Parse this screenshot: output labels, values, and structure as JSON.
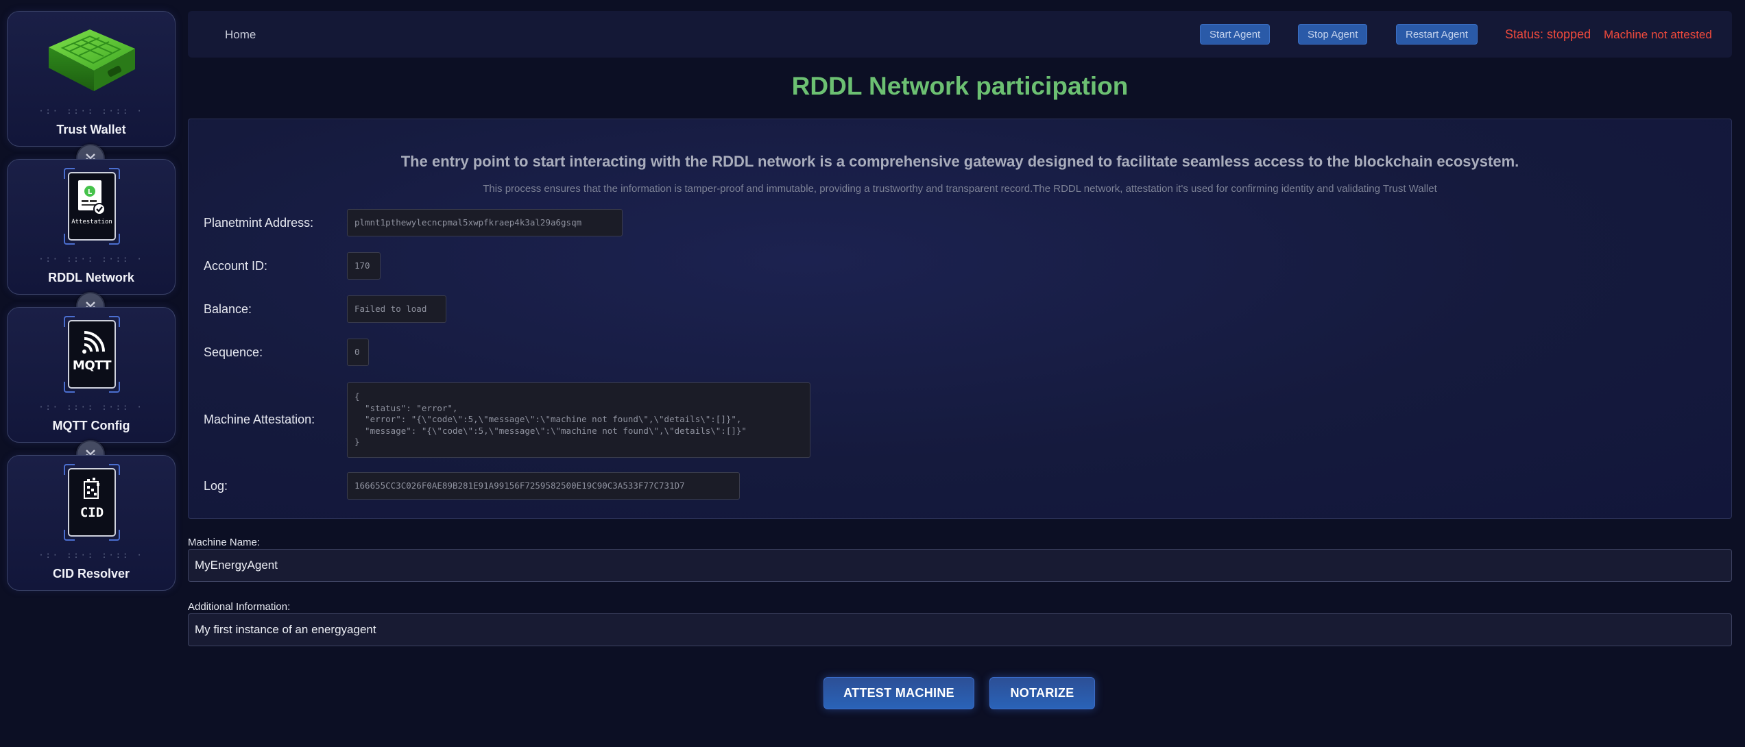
{
  "sidebar": {
    "items": [
      {
        "label": "Trust Wallet",
        "dots": "·:· ::·: :·:: ·",
        "icon": "hardware-wallet-icon"
      },
      {
        "label": "RDDL Network",
        "dots": "·:· ::·: :·:: ·",
        "icon": "attestation-icon",
        "icon_text": "Attestation"
      },
      {
        "label": "MQTT Config",
        "dots": "·:· ::·: :·:: ·",
        "icon": "mqtt-icon",
        "icon_text": "MQTT"
      },
      {
        "label": "CID Resolver",
        "dots": "·:· ::·: :·:: ·",
        "icon": "cid-icon",
        "icon_text": "CID"
      }
    ],
    "connector_icon": "double-chevron-down-icon"
  },
  "topbar": {
    "home": "Home",
    "start": "Start Agent",
    "stop": "Stop Agent",
    "restart": "Restart Agent",
    "status": "Status: stopped",
    "attestation_status": "Machine not attested"
  },
  "title": "RDDL Network participation",
  "panel": {
    "heading": "The entry point to start interacting with the RDDL network is a comprehensive gateway designed to facilitate seamless access to the blockchain ecosystem.",
    "subheading": "This process ensures that the information is tamper-proof and immutable, providing a trustworthy and transparent record.The RDDL network, attestation it's used for confirming identity and validating Trust Wallet",
    "fields": {
      "address_label": "Planetmint Address:",
      "address_value": "plmnt1pthewylecncpmal5xwpfkraep4k3al29a6gsqm",
      "account_label": "Account ID:",
      "account_value": "170",
      "balance_label": "Balance:",
      "balance_value": "Failed to load",
      "sequence_label": "Sequence:",
      "sequence_value": "0",
      "attestation_label": "Machine Attestation:",
      "attestation_value": "{\n  \"status\": \"error\",\n  \"error\": \"{\\\"code\\\":5,\\\"message\\\":\\\"machine not found\\\",\\\"details\\\":[]}\",\n  \"message\": \"{\\\"code\\\":5,\\\"message\\\":\\\"machine not found\\\",\\\"details\\\":[]}\"\n}",
      "log_label": "Log:",
      "log_value": "166655CC3C026F0AE89B281E91A99156F7259582500E19C90C3A533F77C731D7"
    }
  },
  "form": {
    "machine_name_label": "Machine Name:",
    "machine_name_value": "MyEnergyAgent",
    "additional_label": "Additional Information:",
    "additional_value": "My first instance of an energyagent"
  },
  "actions": {
    "attest": "ATTEST MACHINE",
    "notarize": "NOTARIZE"
  },
  "colors": {
    "title": "#6cc072",
    "status": "#f04a3c",
    "button": "#2a5aa8",
    "background": "#0c0f24"
  }
}
